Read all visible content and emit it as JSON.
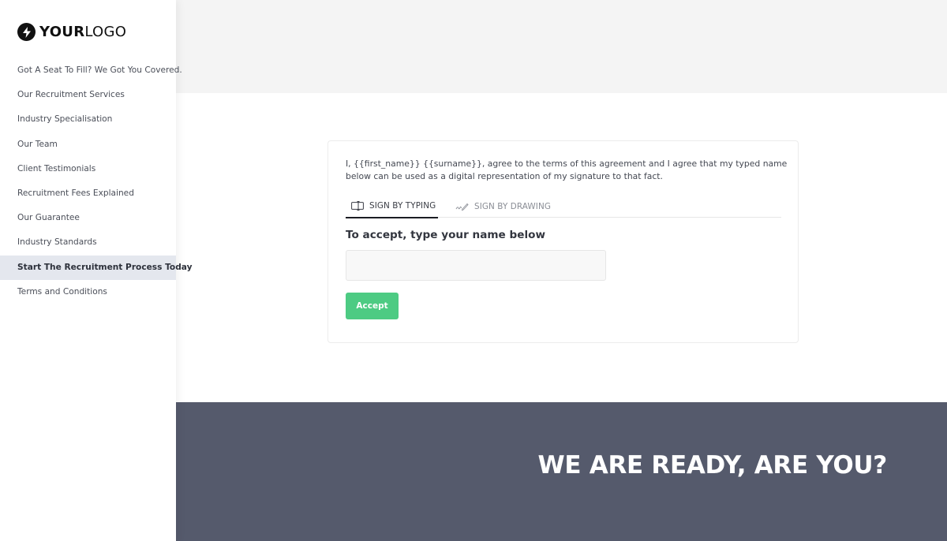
{
  "logo": {
    "icon": "lightning-bolt-icon",
    "bold_text": "YOUR",
    "light_text": "LOGO"
  },
  "sidebar": {
    "items": [
      {
        "label": "Got A Seat To Fill? We Got You Covered.",
        "active": false
      },
      {
        "label": "Our Recruitment Services",
        "active": false
      },
      {
        "label": "Industry Specialisation",
        "active": false
      },
      {
        "label": "Our Team",
        "active": false
      },
      {
        "label": "Client Testimonials",
        "active": false
      },
      {
        "label": "Recruitment Fees Explained",
        "active": false
      },
      {
        "label": "Our Guarantee",
        "active": false
      },
      {
        "label": "Industry Standards",
        "active": false
      },
      {
        "label": "Start The Recruitment Process Today",
        "active": true
      },
      {
        "label": "Terms and Conditions",
        "active": false
      }
    ]
  },
  "signature": {
    "agreement_text": "I, {{first_name}} {{surname}}, agree to the terms of this agreement and I agree that my typed name below can be used as a digital representation of my signature to that fact.",
    "tabs": [
      {
        "label": "SIGN BY TYPING",
        "icon": "text-cursor-box-icon",
        "active": true
      },
      {
        "label": "SIGN BY DRAWING",
        "icon": "pen-signature-icon",
        "active": false
      }
    ],
    "input_label": "To accept, type your name below",
    "input_value": "",
    "input_placeholder": "",
    "accept_label": "Accept"
  },
  "footer": {
    "cta_title": "WE ARE READY, ARE YOU?"
  },
  "colors": {
    "accent_green": "#4dcb83",
    "footer_bg": "#555a6c",
    "active_nav_bg": "#e4e7ee",
    "top_band_bg": "#f4f4f4"
  }
}
